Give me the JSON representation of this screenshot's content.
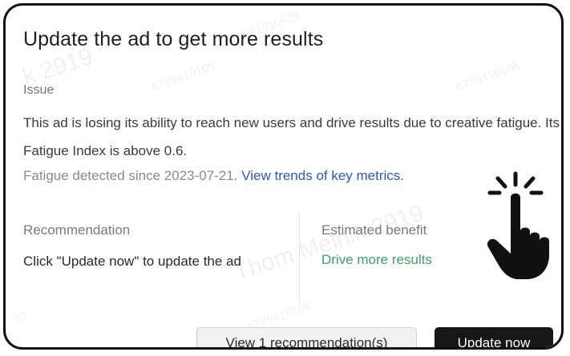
{
  "card": {
    "title": "Update the ad to get more results",
    "issue_label": "Issue",
    "issue_text": "This ad is losing its ability to reach new users and drive results due to creative fatigue. Its Fatigue Index is above 0.6.",
    "fatigue_since": "Fatigue detected since 2023-07-21.",
    "trends_link": "View trends of key metrics.",
    "recommendation_label": "Recommendation",
    "recommendation_text": "Click \"Update now\" to update the ad",
    "benefit_label": "Estimated benefit",
    "benefit_value": "Drive more results",
    "view_recommendations_button": "View 1 recommendation(s)",
    "update_now_button": "Update now"
  },
  "watermarks": [
    "k 2919",
    "6779410106",
    "6779410106",
    "Thom Melnik 2919",
    "6779410106",
    "29",
    "677941010626"
  ],
  "icons": {
    "cursor": "pointing-hand-click-icon"
  },
  "colors": {
    "link": "#2f55c7",
    "benefit": "#3da06a",
    "primary_button": "#171717",
    "secondary_button": "#f1f1f1"
  }
}
